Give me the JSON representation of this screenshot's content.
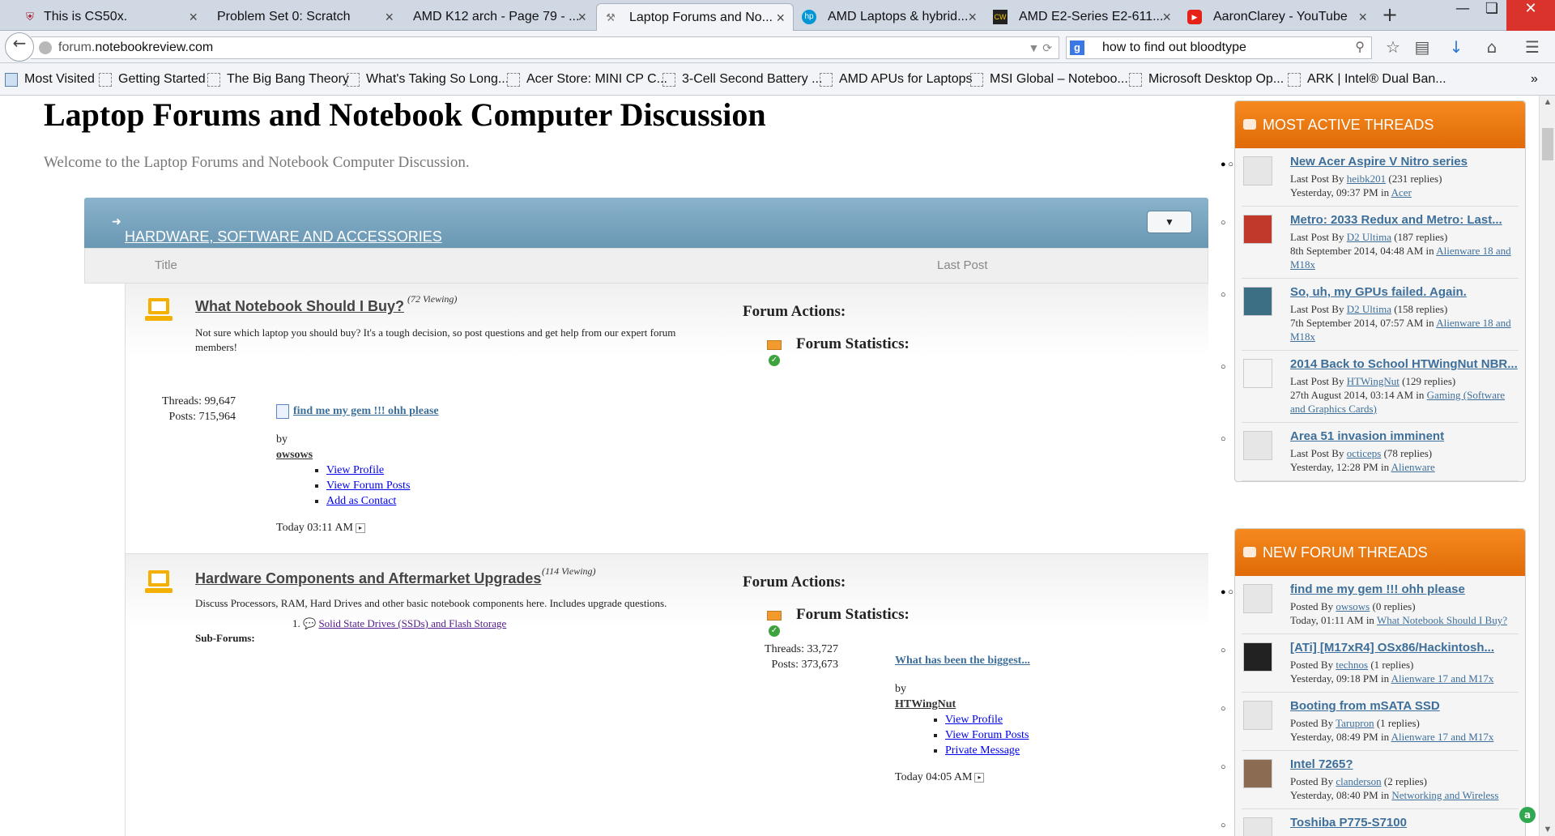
{
  "browser": {
    "tabs": [
      {
        "title": "This is CS50x.",
        "icon": "harvard-shield-icon"
      },
      {
        "title": "Problem Set 0: Scratch",
        "icon": "blank-page-icon"
      },
      {
        "title": "AMD K12 arch - Page 79 - ...",
        "icon": "blank-page-icon"
      },
      {
        "title": "Laptop Forums and No...",
        "icon": "notebookreview-icon",
        "active": true
      },
      {
        "title": "AMD Laptops & hybrid...",
        "icon": "hp-logo-icon"
      },
      {
        "title": "AMD E2-Series E2-611...",
        "icon": "cpuworld-icon"
      },
      {
        "title": "AaronClarey - YouTube",
        "icon": "youtube-icon"
      }
    ],
    "url_prefix": "forum.",
    "url_domain": "notebookreview.com",
    "search_query": "how to find out bloodtype",
    "bookmarks": [
      "Most Visited",
      "Getting Started",
      "The Big Bang Theory",
      "What's Taking So Long...",
      "Acer Store: MINI CP C...",
      "3-Cell Second Battery ...",
      "AMD APUs for Laptops",
      "MSI Global – Noteboo...",
      "Microsoft Desktop Op...",
      "ARK | Intel® Dual Ban..."
    ]
  },
  "page": {
    "title": "Laptop Forums and Notebook Computer Discussion",
    "welcome": "Welcome to the Laptop Forums and Notebook Computer Discussion."
  },
  "category": {
    "name": "HARDWARE, SOFTWARE AND ACCESSORIES",
    "col_title": "Title",
    "col_last_post": "Last Post"
  },
  "forums": [
    {
      "title": "What Notebook Should I Buy?",
      "viewing": "(72 Viewing)",
      "description": "Not sure which laptop you should buy? It's a tough decision, so post questions and get help from our expert forum members!",
      "actions_label": "Forum Actions:",
      "stats_label": "Forum Statistics:",
      "threads": "Threads: 99,647",
      "posts": "Posts: 715,964",
      "last_post_title": "find me my gem !!! ohh please",
      "by": "by",
      "user": "owsows",
      "menu": [
        "View Profile",
        "View Forum Posts",
        "Add as Contact"
      ],
      "time": "Today 03:11 AM"
    },
    {
      "title": "Hardware Components and Aftermarket Upgrades",
      "viewing": "(114 Viewing)",
      "description": "Discuss Processors, RAM, Hard Drives and other basic notebook components here. Includes upgrade questions.",
      "subforums_label": "Sub-Forums:",
      "subforum_num": "1.",
      "subforum": "Solid State Drives (SSDs) and Flash Storage",
      "actions_label": "Forum Actions:",
      "stats_label": "Forum Statistics:",
      "threads": "Threads: 33,727",
      "posts": "Posts: 373,673",
      "last_post_title": "What has been the biggest...",
      "by": "by",
      "user": "HTWingNut",
      "menu": [
        "View Profile",
        "View Forum Posts",
        "Private Message"
      ],
      "time": "Today 04:05 AM"
    }
  ],
  "sidebar": {
    "active": {
      "heading": "MOST ACTIVE THREADS",
      "items": [
        {
          "title": "New Acer Aspire V Nitro series",
          "prefix": "Last Post By ",
          "user": "heibk201",
          "count": " (231 replies)",
          "time": "Yesterday, 09:37 PM in ",
          "forum": "Acer",
          "avatar": "default"
        },
        {
          "title": "Metro: 2033 Redux and Metro: Last...",
          "prefix": "Last Post By ",
          "user": "D2 Ultima",
          "count": " (187 replies)",
          "time": "8th September 2014, 04:48 AM in ",
          "forum": "Alienware 18 and M18x",
          "avatar": "red"
        },
        {
          "title": "So, uh, my GPUs failed. Again.",
          "prefix": "Last Post By ",
          "user": "D2 Ultima",
          "count": " (158 replies)",
          "time": "7th September 2014, 07:57 AM in ",
          "forum": "Alienware 18 and M18x",
          "avatar": "blue"
        },
        {
          "title": "2014 Back to School HTWingNut NBR...",
          "prefix": "Last Post By ",
          "user": "HTWingNut",
          "count": " (129 replies)",
          "time": "27th August 2014, 03:14 AM in ",
          "forum": "Gaming (Software and Graphics Cards)",
          "avatar": "white"
        },
        {
          "title": "Area 51 invasion imminent",
          "prefix": "Last Post By ",
          "user": "octiceps",
          "count": " (78 replies)",
          "time": "Yesterday, 12:28 PM in ",
          "forum": "Alienware",
          "avatar": "default"
        }
      ]
    },
    "new": {
      "heading": "NEW FORUM THREADS",
      "items": [
        {
          "title": "find me my gem !!! ohh please",
          "prefix": "Posted By ",
          "user": "owsows",
          "count": " (0 replies)",
          "time": "Today, 01:11 AM in ",
          "forum": "What Notebook Should I Buy?",
          "avatar": "default"
        },
        {
          "title": "[ATi] [M17xR4] OSx86/Hackintosh...",
          "prefix": "Posted By ",
          "user": "technos",
          "count": " (1 replies)",
          "time": "Yesterday, 09:18 PM in ",
          "forum": "Alienware 17 and M17x",
          "avatar": "dark"
        },
        {
          "title": "Booting from mSATA SSD",
          "prefix": "Posted By ",
          "user": "Tarupron",
          "count": " (1 replies)",
          "time": "Yesterday, 08:49 PM in ",
          "forum": "Alienware 17 and M17x",
          "avatar": "default"
        },
        {
          "title": "Intel 7265?",
          "prefix": "Posted By ",
          "user": "clanderson",
          "count": " (2 replies)",
          "time": "Yesterday, 08:40 PM in ",
          "forum": "Networking and Wireless",
          "avatar": "photo"
        },
        {
          "title": "Toshiba P775-S7100",
          "prefix": "",
          "user": "",
          "count": "",
          "time": "",
          "forum": "",
          "avatar": "default"
        }
      ]
    }
  }
}
